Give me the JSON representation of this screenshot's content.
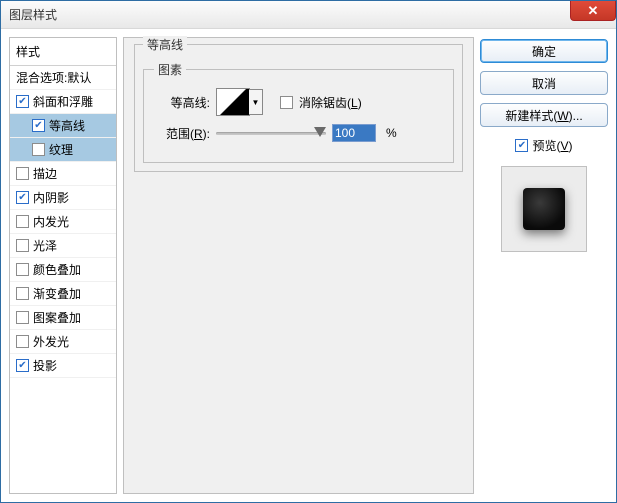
{
  "window": {
    "title": "图层样式"
  },
  "close_glyph": "✕",
  "left": {
    "heading": "样式",
    "blending": "混合选项:默认",
    "items": [
      {
        "label": "斜面和浮雕",
        "checked": true,
        "indent": false,
        "selected": false
      },
      {
        "label": "等高线",
        "checked": true,
        "indent": true,
        "selected": true
      },
      {
        "label": "纹理",
        "checked": false,
        "indent": true,
        "selected": true
      },
      {
        "label": "描边",
        "checked": false,
        "indent": false,
        "selected": false
      },
      {
        "label": "内阴影",
        "checked": true,
        "indent": false,
        "selected": false
      },
      {
        "label": "内发光",
        "checked": false,
        "indent": false,
        "selected": false
      },
      {
        "label": "光泽",
        "checked": false,
        "indent": false,
        "selected": false
      },
      {
        "label": "颜色叠加",
        "checked": false,
        "indent": false,
        "selected": false
      },
      {
        "label": "渐变叠加",
        "checked": false,
        "indent": false,
        "selected": false
      },
      {
        "label": "图案叠加",
        "checked": false,
        "indent": false,
        "selected": false
      },
      {
        "label": "外发光",
        "checked": false,
        "indent": false,
        "selected": false
      },
      {
        "label": "投影",
        "checked": true,
        "indent": false,
        "selected": false
      }
    ]
  },
  "middle": {
    "group_title": "等高线",
    "subgroup_title": "图素",
    "contour_label": "等高线:",
    "antialias_label_prefix": "消除锯齿(",
    "antialias_key": "L",
    "antialias_label_suffix": ")",
    "antialias_checked": false,
    "range_label_prefix": "范围(",
    "range_key": "R",
    "range_label_suffix": "):",
    "range_value": "100",
    "range_unit": "%"
  },
  "right": {
    "ok": "确定",
    "cancel": "取消",
    "new_style_prefix": "新建样式(",
    "new_style_key": "W",
    "new_style_suffix": ")...",
    "preview_prefix": "预览(",
    "preview_key": "V",
    "preview_suffix": ")",
    "preview_checked": true
  }
}
